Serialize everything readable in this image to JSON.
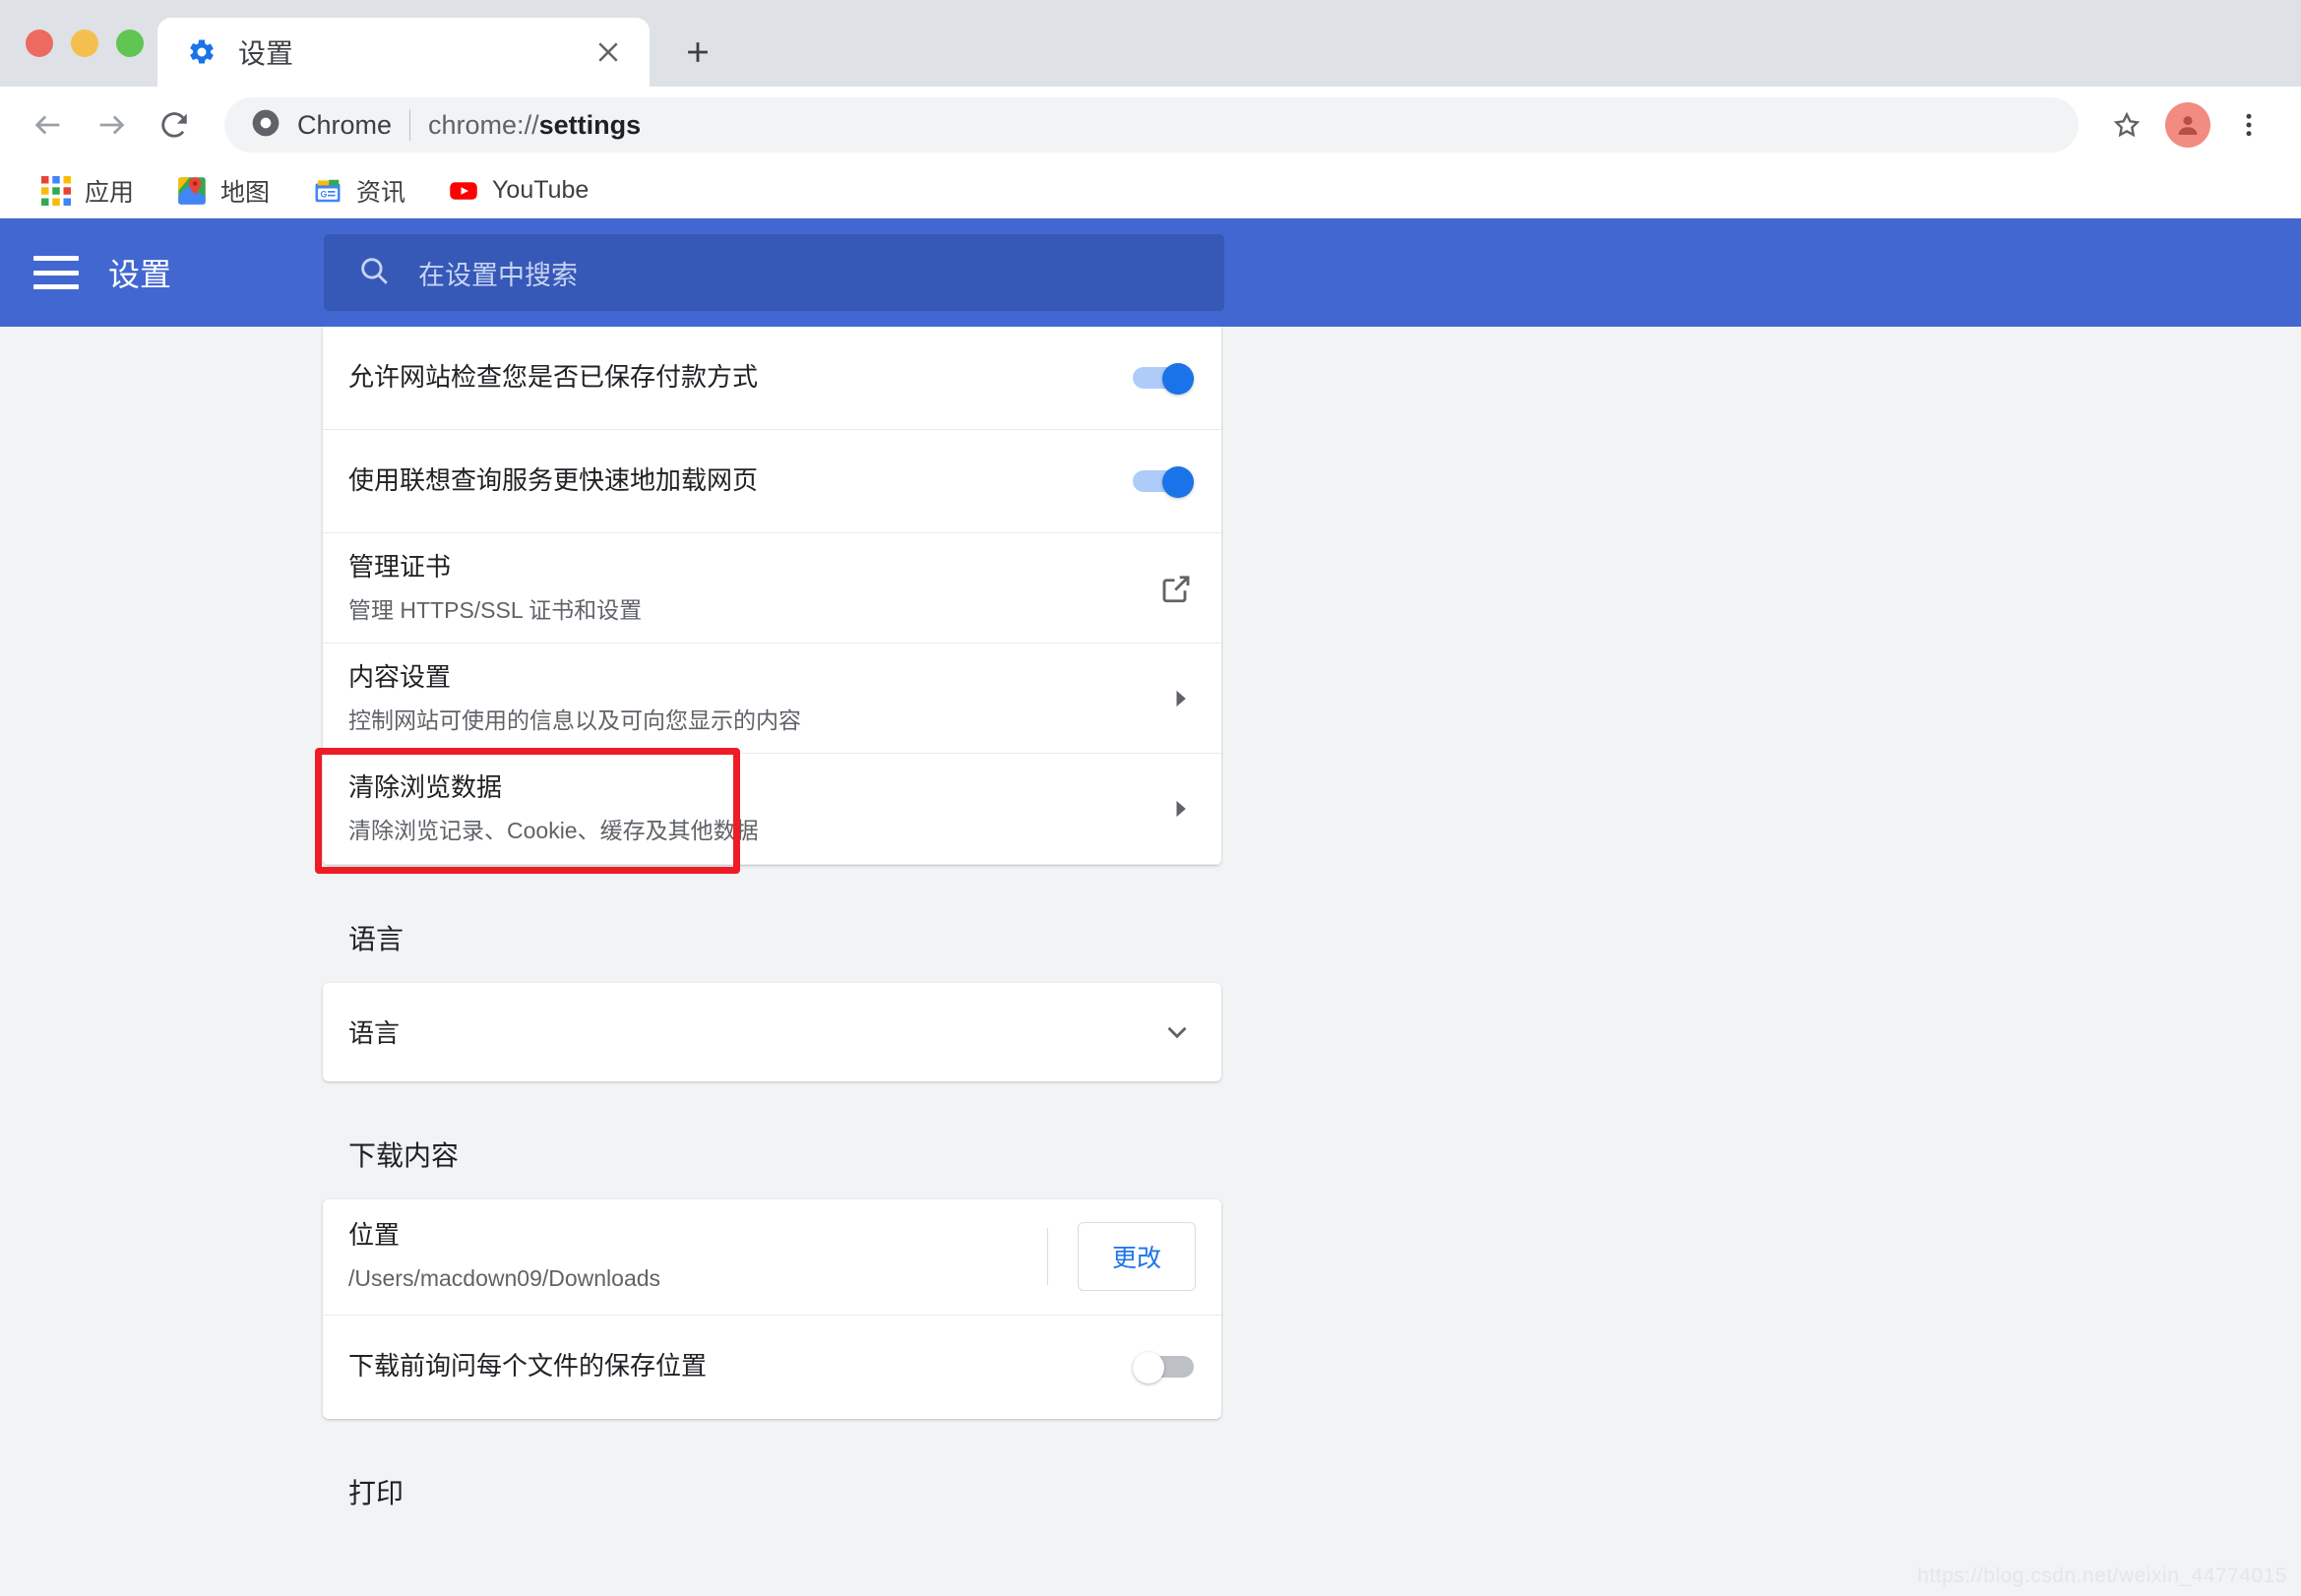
{
  "window": {
    "traffic_lights": [
      "close",
      "minimize",
      "maximize"
    ]
  },
  "tab": {
    "title": "设置",
    "favicon": "gear-icon",
    "close_label": "×",
    "new_tab_label": "+"
  },
  "toolbar": {
    "back": "back-arrow",
    "forward": "forward-arrow",
    "reload": "reload-icon",
    "omnibox": {
      "chip_label": "Chrome",
      "url_prefix": "chrome://",
      "url_bold": "settings"
    },
    "bookmark_star": "star-icon",
    "menu": "three-dot-menu"
  },
  "bookmarks": [
    {
      "label": "应用",
      "icon": "apps-grid-icon"
    },
    {
      "label": "地图",
      "icon": "google-maps-icon"
    },
    {
      "label": "资讯",
      "icon": "google-news-icon"
    },
    {
      "label": "YouTube",
      "icon": "youtube-icon"
    }
  ],
  "settings_header": {
    "title": "设置",
    "menu_icon": "hamburger-icon",
    "search_placeholder": "在设置中搜索",
    "search_value": "",
    "search_icon": "search-icon",
    "bg_color": "#4367d0"
  },
  "privacy_rows": [
    {
      "title": "允许网站检查您是否已保存付款方式",
      "sub": "",
      "control": "toggle",
      "toggle_on": true
    },
    {
      "title": "使用联想查询服务更快速地加载网页",
      "sub": "",
      "control": "toggle",
      "toggle_on": true
    },
    {
      "title": "管理证书",
      "sub": "管理 HTTPS/SSL 证书和设置",
      "control": "external-link"
    },
    {
      "title": "内容设置",
      "sub": "控制网站可使用的信息以及可向您显示的内容",
      "control": "arrow"
    },
    {
      "title": "清除浏览数据",
      "sub": "清除浏览记录、Cookie、缓存及其他数据",
      "control": "arrow",
      "highlighted": true
    }
  ],
  "language_section": {
    "heading": "语言",
    "row_label": "语言",
    "expand_icon": "chevron-down-icon"
  },
  "downloads_section": {
    "heading": "下载内容",
    "location_label": "位置",
    "location_value": "/Users/macdown09/Downloads",
    "change_button": "更改",
    "ask_label": "下载前询问每个文件的保存位置",
    "ask_toggle_on": false
  },
  "print_section": {
    "heading": "打印"
  },
  "annotation": {
    "highlight_color": "#ee1c25"
  },
  "watermark": "https://blog.csdn.net/weixin_44774015"
}
